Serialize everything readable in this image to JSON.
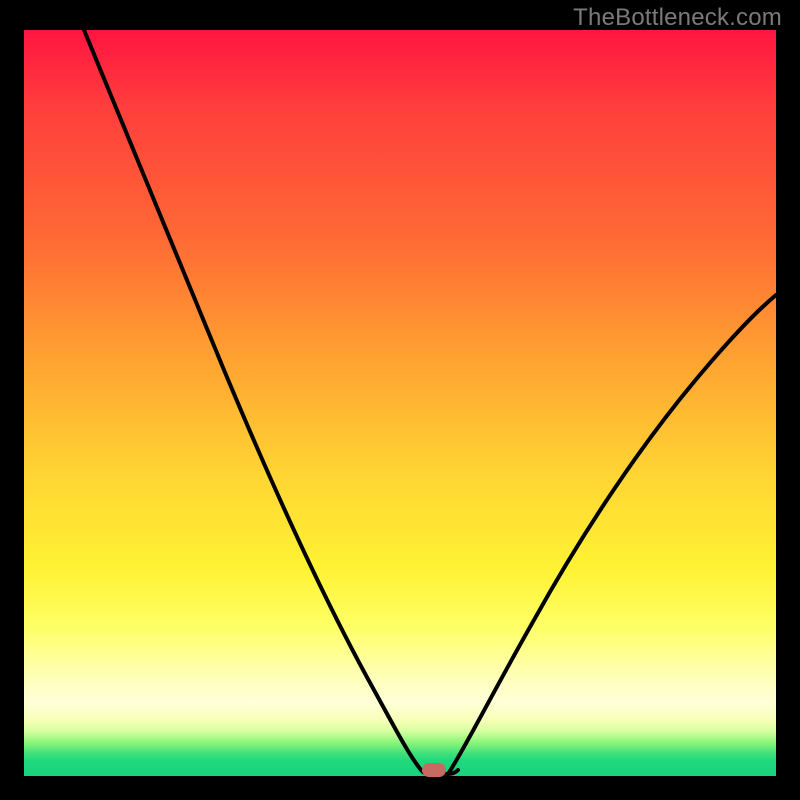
{
  "watermark": "TheBottleneck.com",
  "colors": {
    "marker": "#c66a62",
    "curve": "#000000"
  },
  "chart_data": {
    "type": "line",
    "title": "",
    "xlabel": "",
    "ylabel": "",
    "xlim": [
      0,
      100
    ],
    "ylim": [
      0,
      100
    ],
    "grid": false,
    "series": [
      {
        "name": "bottleneck-curve",
        "x": [
          8,
          12,
          16,
          20,
          24,
          28,
          32,
          36,
          40,
          44,
          48,
          50,
          52,
          54,
          56,
          58,
          62,
          66,
          70,
          75,
          80,
          85,
          90,
          95,
          100
        ],
        "values": [
          100,
          92,
          84,
          76,
          68,
          60,
          52,
          44,
          36,
          28,
          19,
          10,
          2,
          1,
          1,
          3,
          10,
          18,
          25,
          33,
          40,
          47,
          53,
          58,
          63
        ]
      }
    ],
    "annotations": [
      {
        "name": "optimum-marker",
        "x": 54,
        "y": 1
      }
    ]
  }
}
